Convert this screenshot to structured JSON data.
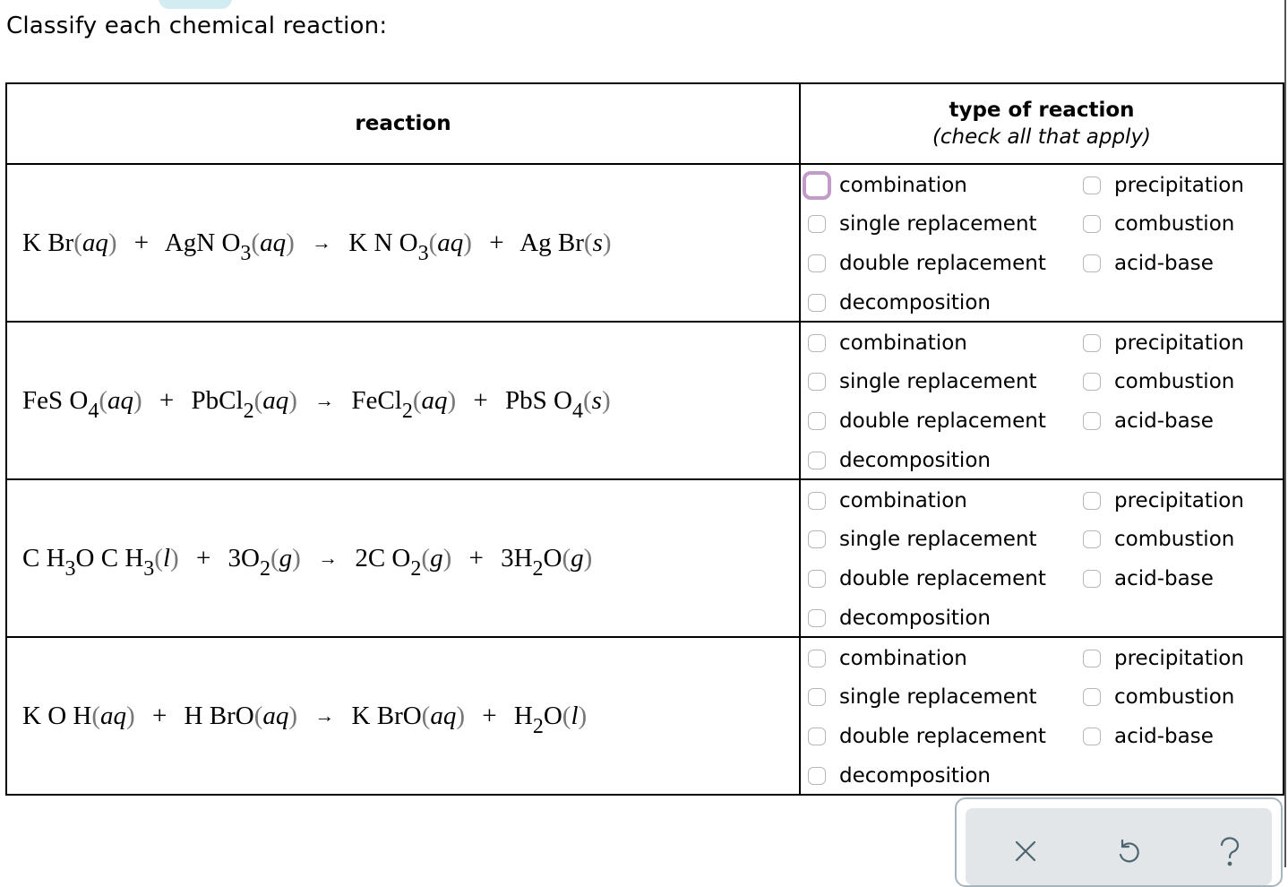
{
  "prompt": "Classify each chemical reaction:",
  "table": {
    "header_reaction": "reaction",
    "header_type": "type of reaction",
    "header_type_note": "(check all that apply)"
  },
  "option_labels": [
    "combination",
    "single replacement",
    "double replacement",
    "decomposition",
    "precipitation",
    "combustion",
    "acid-base"
  ],
  "reactions": [
    {
      "equation": "KBr(aq) + AgNO3(aq) → KNO3(aq) + AgBr(s)",
      "parts": {
        "r1": "K Br",
        "r1s": "aq",
        "r2": "AgN O",
        "r2sub": "3",
        "r2s": "aq",
        "p1": "K N O",
        "p1sub": "3",
        "p1s": "aq",
        "p2": "Ag Br",
        "p2s": "s"
      },
      "options": {
        "combination": false,
        "single_replacement": false,
        "double_replacement": false,
        "decomposition": false,
        "precipitation": false,
        "combustion": false,
        "acid_base": false
      }
    },
    {
      "equation": "FeSO4(aq) + PbCl2(aq) → FeCl2(aq) + PbSO4(s)",
      "parts": {
        "r1": "FeS O",
        "r1sub": "4",
        "r1s": "aq",
        "r2": "PbCl",
        "r2sub": "2",
        "r2s": "aq",
        "p1": "FeCl",
        "p1sub": "2",
        "p1s": "aq",
        "p2": "PbS O",
        "p2sub": "4",
        "p2s": "s"
      },
      "options": {
        "combination": false,
        "single_replacement": false,
        "double_replacement": false,
        "decomposition": false,
        "precipitation": false,
        "combustion": false,
        "acid_base": false
      }
    },
    {
      "equation": "CH3OCH3(l) + 3O2(g) → 2CO2(g) + 3H2O(g)",
      "parts": {
        "r1a": "C H",
        "r1asub": "3",
        "r1b": "O C H",
        "r1bsub": "3",
        "r1s": "l",
        "r2": "3O",
        "r2sub": "2",
        "r2s": "g",
        "p1": "2C O",
        "p1sub": "2",
        "p1s": "g",
        "p2a": "3H",
        "p2asub": "2",
        "p2b": "O",
        "p2s": "g"
      },
      "options": {
        "combination": false,
        "single_replacement": false,
        "double_replacement": false,
        "decomposition": false,
        "precipitation": false,
        "combustion": false,
        "acid_base": false
      }
    },
    {
      "equation": "KOH(aq) + HBrO(aq) → KBrO(aq) + H2O(l)",
      "parts": {
        "r1": "K O H",
        "r1s": "aq",
        "r2": "H BrO",
        "r2s": "aq",
        "p1": "K BrO",
        "p1s": "aq",
        "p2a": "H",
        "p2asub": "2",
        "p2b": "O",
        "p2s": "l"
      },
      "options": {
        "combination": false,
        "single_replacement": false,
        "double_replacement": false,
        "decomposition": false,
        "precipitation": false,
        "combustion": false,
        "acid_base": false
      }
    }
  ],
  "symbols": {
    "plus": "+",
    "arrow": "→",
    "lparen": "(",
    "rparen": ")"
  },
  "toolbar": {
    "clear_icon": "x-icon",
    "undo_icon": "undo-icon",
    "help_icon": "question-icon"
  },
  "colors": {
    "focus_ring": "#c29bc9",
    "toolbar_bg": "#e2e6e9",
    "toolbar_icon": "#4d6570",
    "top_tab": "#d3ecf2"
  }
}
